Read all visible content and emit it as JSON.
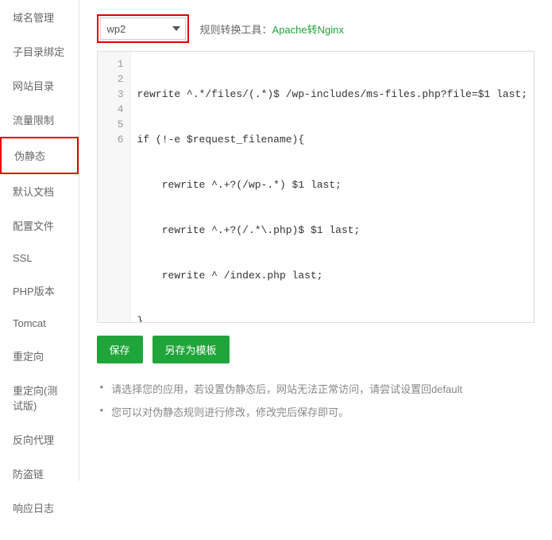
{
  "sidebar": {
    "items": [
      {
        "label": "域名管理"
      },
      {
        "label": "子目录绑定"
      },
      {
        "label": "网站目录"
      },
      {
        "label": "流量限制"
      },
      {
        "label": "伪静态"
      },
      {
        "label": "默认文档"
      },
      {
        "label": "配置文件"
      },
      {
        "label": "SSL"
      },
      {
        "label": "PHP版本"
      },
      {
        "label": "Tomcat"
      },
      {
        "label": "重定向"
      },
      {
        "label": "重定向(测试版)"
      },
      {
        "label": "反向代理"
      },
      {
        "label": "防盗链"
      },
      {
        "label": "响应日志"
      }
    ]
  },
  "toolbar": {
    "select_value": "wp2",
    "tool_label": "规则转换工具：",
    "tool_link": "Apache转Nginx"
  },
  "editor": {
    "lines": [
      "rewrite ^.*/files/(.*)$ /wp-includes/ms-files.php?file=$1 last;",
      "if (!-e $request_filename){",
      "    rewrite ^.+?(/wp-.*) $1 last;",
      "    rewrite ^.+?(/.*\\.php)$ $1 last;",
      "    rewrite ^ /index.php last;",
      "}"
    ]
  },
  "buttons": {
    "save": "保存",
    "save_as": "另存为模板"
  },
  "notes": {
    "n1": "请选择您的应用，若设置伪静态后，网站无法正常访问，请尝试设置回default",
    "n2": "您可以对伪静态规则进行修改，修改完后保存即可。"
  }
}
